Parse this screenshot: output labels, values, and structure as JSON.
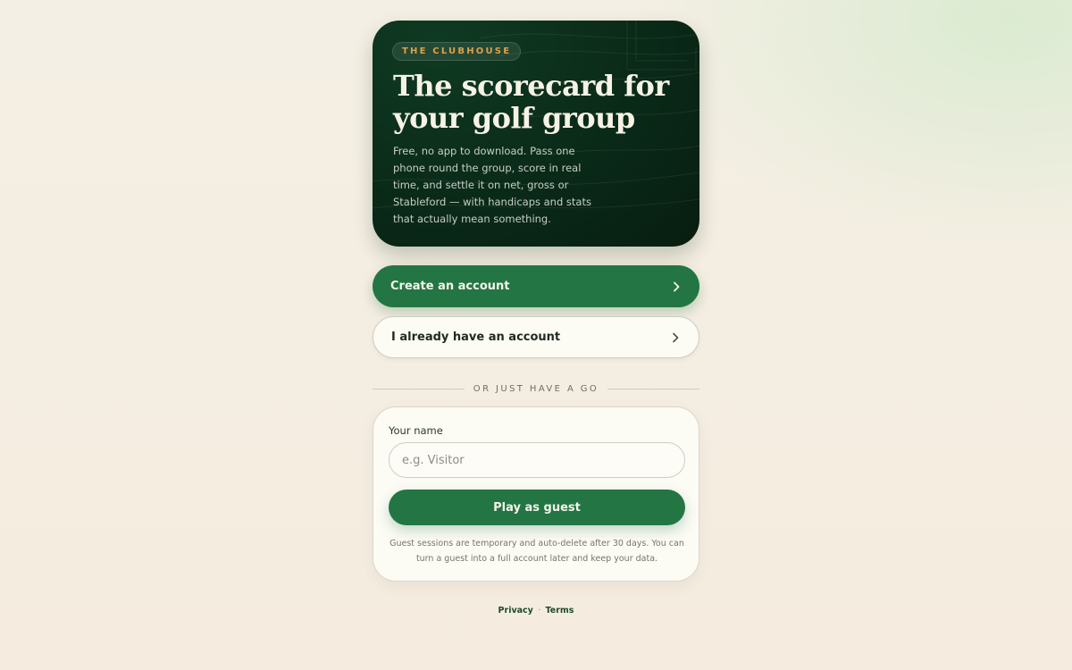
{
  "hero": {
    "badge": "THE CLUBHOUSE",
    "title": "The scorecard for your golf group",
    "description": "Free, no app to download. Pass one phone round the group, score in real time, and settle it on net, gross or Stableford — with handicaps and stats that actually mean something."
  },
  "actions": {
    "create_account": "Create an account",
    "sign_in": "I already have an account",
    "chevron_icon": "chevron-right-icon"
  },
  "divider": {
    "text": "OR JUST HAVE A GO"
  },
  "guest": {
    "name_label": "Your name",
    "name_value": "",
    "name_placeholder": "e.g. Visitor",
    "play_button": "Play as guest",
    "note": "Guest sessions are temporary and auto-delete after 30 days. You can turn a guest into a full account later and keep your data."
  },
  "footer": {
    "privacy": "Privacy",
    "separator": "·",
    "terms": "Terms"
  },
  "colors": {
    "brand_green": "#247544",
    "hero_dark": "#0a2a18",
    "badge_gold": "#d9a24a",
    "background": "#f4efe4"
  }
}
